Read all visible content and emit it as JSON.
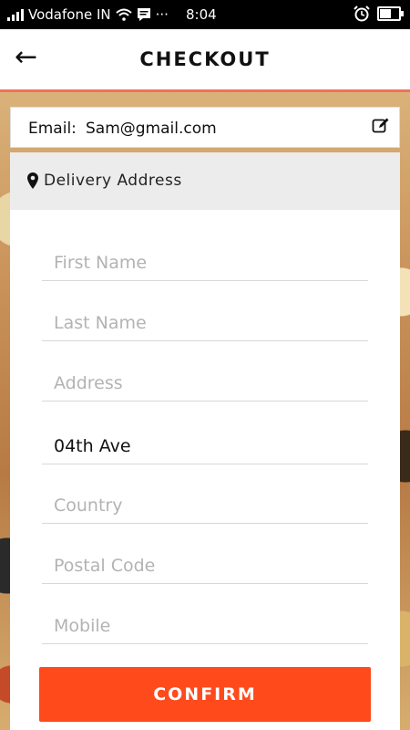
{
  "status_bar": {
    "carrier": "Vodafone IN",
    "time": "8:04",
    "extra": "···"
  },
  "header": {
    "title": "CHECKOUT",
    "back_icon": "arrow-left-icon"
  },
  "email": {
    "label": "Email:",
    "value": "Sam@gmail.com",
    "edit_icon": "edit-icon"
  },
  "delivery": {
    "title": "Delivery Address",
    "icon": "map-pin-icon"
  },
  "form": {
    "first_name": {
      "placeholder": "First Name",
      "value": ""
    },
    "last_name": {
      "placeholder": "Last Name",
      "value": ""
    },
    "address": {
      "placeholder": "Address",
      "value": ""
    },
    "street": {
      "placeholder": "",
      "value": "04th Ave"
    },
    "country": {
      "placeholder": "Country",
      "value": ""
    },
    "postal_code": {
      "placeholder": "Postal Code",
      "value": ""
    },
    "mobile": {
      "placeholder": "Mobile",
      "value": ""
    }
  },
  "confirm_label": "CONFIRM",
  "colors": {
    "accent": "#ff4a1c",
    "header_border": "#f2705a"
  }
}
